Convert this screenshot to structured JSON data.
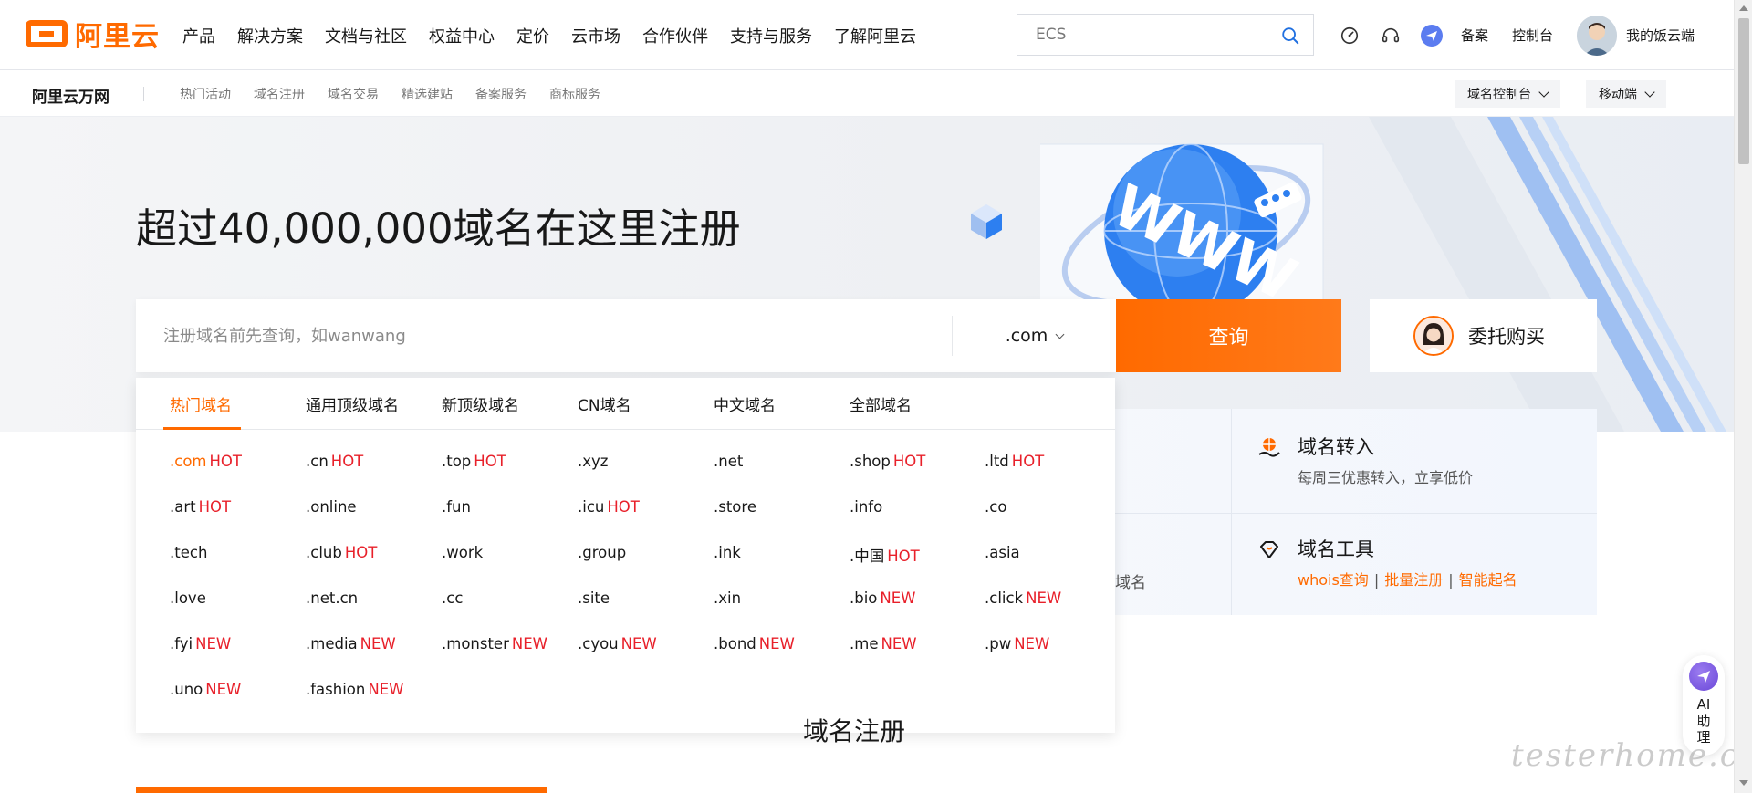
{
  "header": {
    "logo_text": "阿里云",
    "nav": [
      "产品",
      "解决方案",
      "文档与社区",
      "权益中心",
      "定价",
      "云市场",
      "合作伙伴",
      "支持与服务",
      "了解阿里云"
    ],
    "search_placeholder": "ECS",
    "links": {
      "beian": "备案",
      "console": "控制台"
    },
    "user_name": "我的饭云端"
  },
  "subnav": {
    "brand": "阿里云万网",
    "links": [
      "热门活动",
      "域名注册",
      "域名交易",
      "精选建站",
      "备案服务",
      "商标服务"
    ],
    "buttons": {
      "domain_console": "域名控制台",
      "mobile": "移动端"
    }
  },
  "hero": {
    "title": "超过40,000,000域名在这里注册",
    "search_placeholder": "注册域名前先查询，如wanwang",
    "selected_tld": ".com",
    "query_button": "查询",
    "broker_button": "委托购买"
  },
  "services": {
    "transfer": {
      "title": "域名转入",
      "desc": "每周三优惠转入，立享低价"
    },
    "tools": {
      "title": "域名工具",
      "links": [
        "whois查询",
        "批量注册",
        "智能起名"
      ]
    },
    "partial_text": "域名"
  },
  "dropdown": {
    "tabs": [
      "热门域名",
      "通用顶级域名",
      "新顶级域名",
      "CN域名",
      "中文域名",
      "全部域名"
    ],
    "active_tab": "热门域名",
    "rows": [
      [
        {
          "name": ".com",
          "tag": "HOT",
          "hl": true
        },
        {
          "name": ".cn",
          "tag": "HOT"
        },
        {
          "name": ".top",
          "tag": "HOT"
        },
        {
          "name": ".xyz",
          "tag": ""
        },
        {
          "name": ".net",
          "tag": ""
        },
        {
          "name": ".shop",
          "tag": "HOT"
        },
        {
          "name": ".ltd",
          "tag": "HOT"
        }
      ],
      [
        {
          "name": ".art",
          "tag": "HOT"
        },
        {
          "name": ".online",
          "tag": ""
        },
        {
          "name": ".fun",
          "tag": ""
        },
        {
          "name": ".icu",
          "tag": "HOT"
        },
        {
          "name": ".store",
          "tag": ""
        },
        {
          "name": ".info",
          "tag": ""
        },
        {
          "name": ".co",
          "tag": ""
        }
      ],
      [
        {
          "name": ".tech",
          "tag": ""
        },
        {
          "name": ".club",
          "tag": "HOT"
        },
        {
          "name": ".work",
          "tag": ""
        },
        {
          "name": ".group",
          "tag": ""
        },
        {
          "name": ".ink",
          "tag": ""
        },
        {
          "name": ".中国",
          "tag": "HOT"
        },
        {
          "name": ".asia",
          "tag": ""
        }
      ],
      [
        {
          "name": ".love",
          "tag": ""
        },
        {
          "name": ".net.cn",
          "tag": ""
        },
        {
          "name": ".cc",
          "tag": ""
        },
        {
          "name": ".site",
          "tag": ""
        },
        {
          "name": ".xin",
          "tag": ""
        },
        {
          "name": ".bio",
          "tag": "NEW"
        },
        {
          "name": ".click",
          "tag": "NEW"
        }
      ],
      [
        {
          "name": ".fyi",
          "tag": "NEW"
        },
        {
          "name": ".media",
          "tag": "NEW"
        },
        {
          "name": ".monster",
          "tag": "NEW"
        },
        {
          "name": ".cyou",
          "tag": "NEW"
        },
        {
          "name": ".bond",
          "tag": "NEW"
        },
        {
          "name": ".me",
          "tag": "NEW"
        },
        {
          "name": ".pw",
          "tag": "NEW"
        }
      ],
      [
        {
          "name": ".uno",
          "tag": "NEW"
        },
        {
          "name": ".fashion",
          "tag": "NEW"
        }
      ]
    ]
  },
  "section_peek": "域名注册",
  "ai_assistant": {
    "label_lines": [
      "AI",
      "助",
      "理"
    ]
  },
  "watermark": "testerhome.com",
  "colors": {
    "brand": "#ff6a00",
    "tag_red": "#e8202a",
    "ai_purple": "#6a47d8"
  },
  "icons": [
    "search-icon",
    "speed-icon",
    "headset-icon",
    "plane-icon",
    "globe-hand-icon",
    "diamond-heart-icon"
  ]
}
